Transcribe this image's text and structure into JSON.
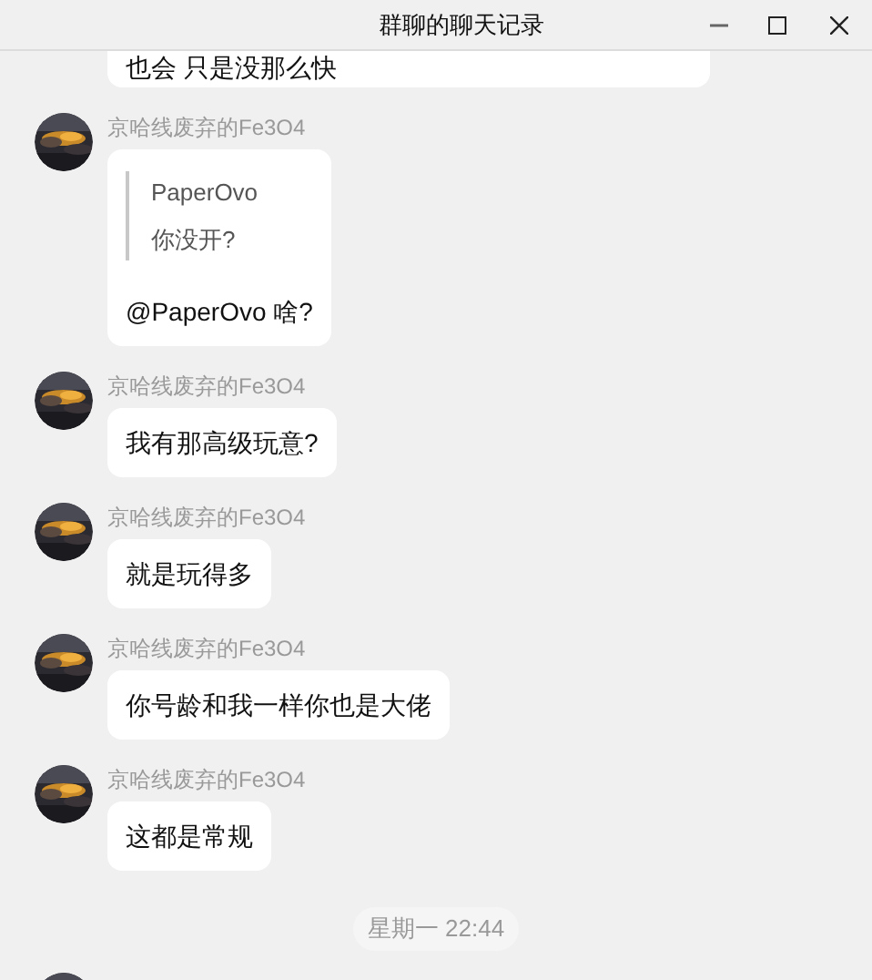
{
  "window": {
    "title": "群聊的聊天记录"
  },
  "messages": [
    {
      "kind": "text",
      "text": "也会 只是没那么快"
    },
    {
      "kind": "quote",
      "sender": "京哈线废弃的Fe3O4",
      "quote_author": "PaperOvo",
      "quote_text": "你没开?",
      "text": "@PaperOvo 啥?"
    },
    {
      "kind": "text",
      "sender": "京哈线废弃的Fe3O4",
      "text": "我有那高级玩意?"
    },
    {
      "kind": "text",
      "sender": "京哈线废弃的Fe3O4",
      "text": "就是玩得多"
    },
    {
      "kind": "text",
      "sender": "京哈线废弃的Fe3O4",
      "text": "你号龄和我一样你也是大佬"
    },
    {
      "kind": "text",
      "sender": "京哈线废弃的Fe3O4",
      "text": "这都是常规"
    },
    {
      "kind": "time",
      "text": "星期一 22:44"
    },
    {
      "kind": "cut"
    }
  ]
}
